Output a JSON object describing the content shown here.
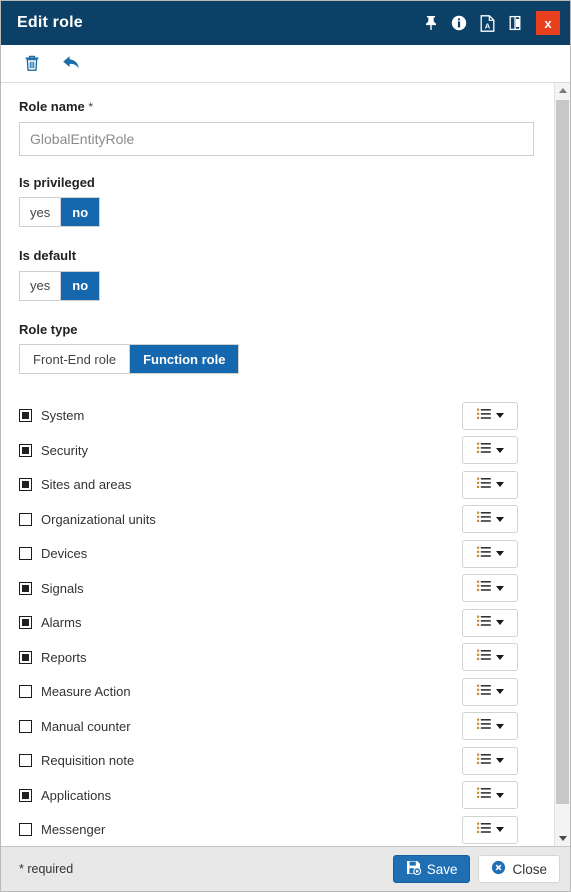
{
  "window": {
    "title": "Edit role",
    "title_actions": [
      {
        "name": "pin-icon",
        "label": "Pin"
      },
      {
        "name": "info-icon",
        "label": "Info"
      },
      {
        "name": "pdf-export-icon",
        "label": "Export PDF"
      },
      {
        "name": "split-panel-icon",
        "label": "Split panel"
      }
    ],
    "close_label": "x"
  },
  "toolbar": {
    "items": [
      {
        "name": "delete-icon",
        "label": "Delete"
      },
      {
        "name": "undo-icon",
        "label": "Undo"
      }
    ]
  },
  "form": {
    "role_name": {
      "label": "Role name",
      "required_marker": "*",
      "value": "GlobalEntityRole",
      "placeholder": "GlobalEntityRole"
    },
    "is_privileged": {
      "label": "Is privileged",
      "options": [
        "yes",
        "no"
      ],
      "selected": "no"
    },
    "is_default": {
      "label": "Is default",
      "options": [
        "yes",
        "no"
      ],
      "selected": "no"
    },
    "role_type": {
      "label": "Role type",
      "options": [
        "Front-End role",
        "Function role"
      ],
      "selected": "Function role"
    }
  },
  "permissions": {
    "rows": [
      {
        "label": "System",
        "state": "indeterminate"
      },
      {
        "label": "Security",
        "state": "indeterminate"
      },
      {
        "label": "Sites and areas",
        "state": "indeterminate"
      },
      {
        "label": "Organizational units",
        "state": "unchecked"
      },
      {
        "label": "Devices",
        "state": "unchecked"
      },
      {
        "label": "Signals",
        "state": "indeterminate"
      },
      {
        "label": "Alarms",
        "state": "indeterminate"
      },
      {
        "label": "Reports",
        "state": "indeterminate"
      },
      {
        "label": "Measure Action",
        "state": "unchecked"
      },
      {
        "label": "Manual counter",
        "state": "unchecked"
      },
      {
        "label": "Requisition note",
        "state": "unchecked"
      },
      {
        "label": "Applications",
        "state": "indeterminate"
      },
      {
        "label": "Messenger",
        "state": "unchecked"
      }
    ],
    "dropdown_icon": "list-icon",
    "dropdown_chevron": "chevron-down-icon"
  },
  "footer": {
    "note": "* required",
    "save_label": "Save",
    "close_label": "Close"
  },
  "colors": {
    "titlebar": "#0d4066",
    "accent": "#1568ad",
    "primary_button": "#1f6fb5",
    "close_button": "#e8401f",
    "footer_bg": "#e8e8e8",
    "toolbar_icon": "#1d6ca8"
  }
}
